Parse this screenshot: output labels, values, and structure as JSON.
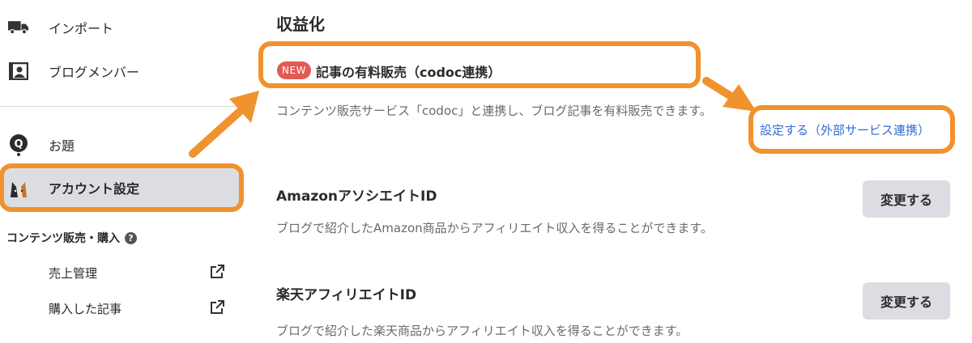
{
  "sidebar": {
    "items": [
      {
        "label": "インポート",
        "icon": "truck-icon"
      },
      {
        "label": "ブログメンバー",
        "icon": "members-icon"
      },
      {
        "label": "お題",
        "icon": "odai-icon"
      },
      {
        "label": "アカウント設定",
        "icon": "avatar-cat-icon"
      }
    ],
    "section_title": "コンテンツ販売・購入",
    "section_help": "?",
    "sub_items": [
      {
        "label": "売上管理",
        "icon": "external-link-icon"
      },
      {
        "label": "購入した記事",
        "icon": "external-link-icon"
      }
    ]
  },
  "main": {
    "title": "収益化",
    "codoc": {
      "badge": "NEW",
      "title": "記事の有料販売（codoc連携）",
      "description": "コンテンツ販売サービス「codoc」と連携し、ブログ記事を有料販売できます。",
      "link": "設定する（外部サービス連携）"
    },
    "amazon": {
      "title": "AmazonアソシエイトID",
      "description": "ブログで紹介したAmazon商品からアフィリエイト収入を得ることができます。",
      "button": "変更する"
    },
    "rakuten": {
      "title": "楽天アフィリエイトID",
      "description": "ブログで紹介した楽天商品からアフィリエイト収入を得ることができます。",
      "button": "変更する"
    }
  },
  "annotation_color": "#f0922e"
}
